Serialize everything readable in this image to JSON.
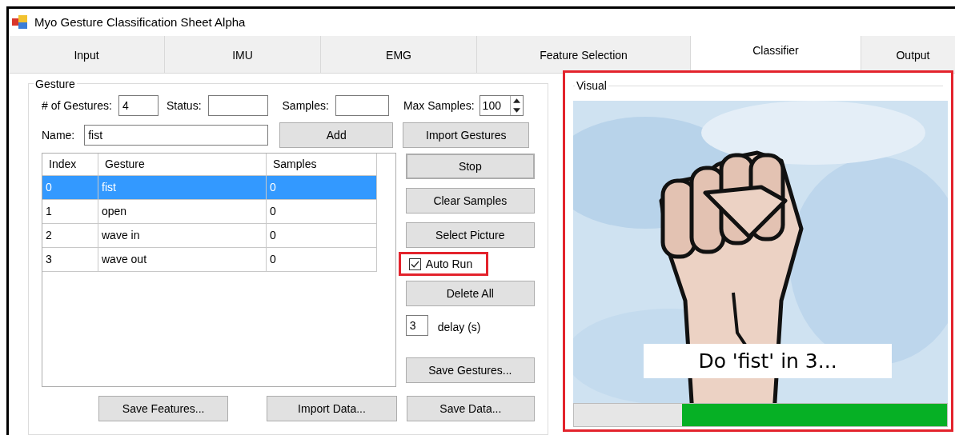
{
  "window": {
    "title": "Myo Gesture Classification Sheet Alpha"
  },
  "tabs": [
    {
      "label": "Input",
      "selected": false
    },
    {
      "label": "IMU",
      "selected": false
    },
    {
      "label": "EMG",
      "selected": false
    },
    {
      "label": "Feature Selection",
      "selected": false
    },
    {
      "label": "Classifier",
      "selected": true
    },
    {
      "label": "Output",
      "selected": false
    }
  ],
  "gesture_group": {
    "legend": "Gesture",
    "num_gestures": {
      "label": "# of Gestures:",
      "value": "4"
    },
    "status": {
      "label": "Status:"
    },
    "samples": {
      "label": "Samples:"
    },
    "max_samples": {
      "label": "Max Samples:",
      "value": "100"
    },
    "name": {
      "label": "Name:",
      "value": "fist"
    },
    "add_button": "Add",
    "table": {
      "columns": [
        "Index",
        "Gesture",
        "Samples"
      ],
      "rows": [
        {
          "cells": [
            "0",
            "fist",
            "0"
          ],
          "selected": true
        },
        {
          "cells": [
            "1",
            "open",
            "0"
          ],
          "selected": false
        },
        {
          "cells": [
            "2",
            "wave in",
            "0"
          ],
          "selected": false
        },
        {
          "cells": [
            "3",
            "wave out",
            "0"
          ],
          "selected": false
        }
      ]
    },
    "side_buttons": [
      "Import Gestures",
      "Stop",
      "Clear Samples",
      "Select Picture"
    ],
    "auto_run": {
      "label": "Auto Run",
      "checked": true,
      "highlighted": true
    },
    "delete_button": "Delete All",
    "delay": {
      "value": "3",
      "label": "delay (s)"
    },
    "save_gestures_button": "Save Gestures...",
    "bottom_buttons": [
      "Save Features...",
      "Import Data...",
      "Save Data..."
    ]
  },
  "visual_group": {
    "legend": "Visual",
    "highlighted": true,
    "caption": "Do 'fist' in 3...",
    "progress": {
      "level": 0.71
    }
  }
}
